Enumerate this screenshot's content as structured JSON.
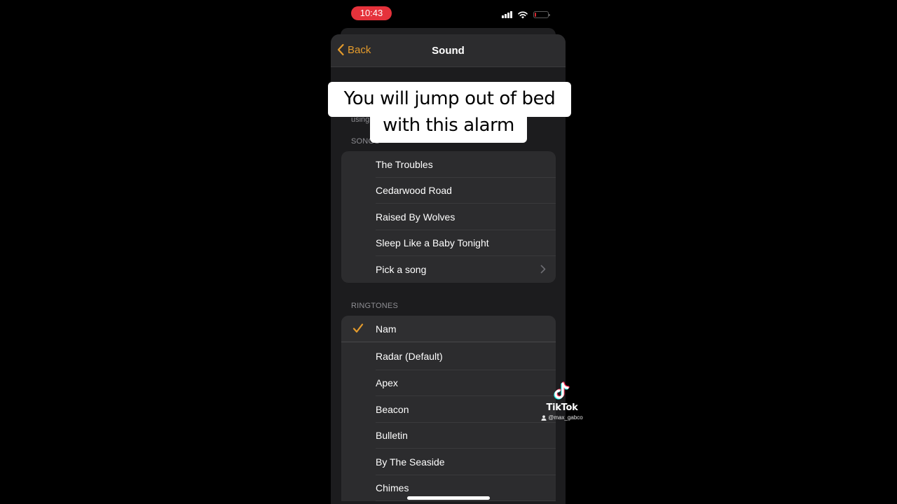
{
  "status_bar": {
    "time": "10:43",
    "icons": [
      "signal-icon",
      "wifi-icon",
      "battery-low-icon"
    ],
    "time_pill_color": "#e5323b"
  },
  "navbar": {
    "back_label": "Back",
    "title": "Sound",
    "accent_color": "#e49b2c"
  },
  "partial_text": "using",
  "sections": {
    "songs": {
      "header": "SONGS",
      "items": [
        {
          "label": "The Troubles"
        },
        {
          "label": "Cedarwood Road"
        },
        {
          "label": "Raised By Wolves"
        },
        {
          "label": "Sleep Like a Baby Tonight"
        },
        {
          "label": "Pick a song",
          "disclosure": true
        }
      ]
    },
    "ringtones": {
      "header": "RINGTONES",
      "selected": "Nam",
      "items": [
        {
          "label": "Nam",
          "checked": true
        },
        {
          "label": "Radar (Default)"
        },
        {
          "label": "Apex"
        },
        {
          "label": "Beacon"
        },
        {
          "label": "Bulletin"
        },
        {
          "label": "By The Seaside"
        },
        {
          "label": "Chimes"
        }
      ]
    }
  },
  "caption": {
    "line1": "You will jump out of bed",
    "line2": "with this alarm"
  },
  "watermark": {
    "brand": "TikTok",
    "username": "@max_gabco"
  }
}
